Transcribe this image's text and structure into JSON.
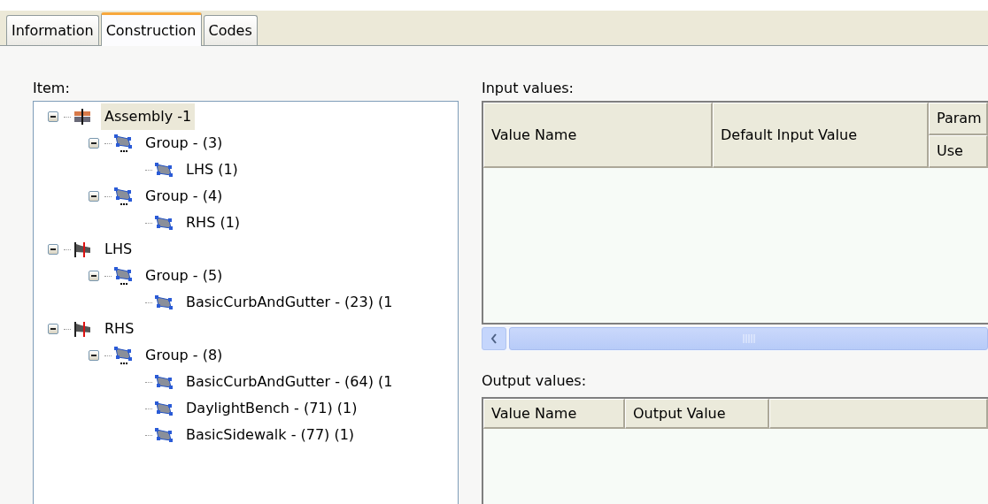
{
  "tabs": [
    {
      "label": "Information",
      "selected": false
    },
    {
      "label": "Construction",
      "selected": true
    },
    {
      "label": "Codes",
      "selected": false
    }
  ],
  "item_tree": {
    "label": "Item:",
    "nodes": [
      {
        "label": "Assembly -1",
        "kind": "assembly",
        "selected": true,
        "expanded": true,
        "children": [
          {
            "label": "Group - (3)",
            "kind": "group",
            "selected": false,
            "expanded": true,
            "children": [
              {
                "label": "LHS (1)",
                "kind": "subassembly",
                "selected": false
              }
            ]
          },
          {
            "label": "Group - (4)",
            "kind": "group",
            "selected": false,
            "expanded": true,
            "children": [
              {
                "label": "RHS (1)",
                "kind": "subassembly",
                "selected": false
              }
            ]
          }
        ]
      },
      {
        "label": "LHS",
        "kind": "baseline",
        "selected": false,
        "expanded": true,
        "children": [
          {
            "label": "Group - (5)",
            "kind": "group",
            "selected": false,
            "expanded": true,
            "children": [
              {
                "label": "BasicCurbAndGutter - (23) (1",
                "kind": "subassembly",
                "selected": false
              }
            ]
          }
        ]
      },
      {
        "label": "RHS",
        "kind": "baseline",
        "selected": false,
        "expanded": true,
        "children": [
          {
            "label": "Group - (8)",
            "kind": "group",
            "selected": false,
            "expanded": true,
            "children": [
              {
                "label": "BasicCurbAndGutter - (64) (1",
                "kind": "subassembly",
                "selected": false
              },
              {
                "label": "DaylightBench - (71) (1)",
                "kind": "subassembly",
                "selected": false
              },
              {
                "label": "BasicSidewalk - (77) (1)",
                "kind": "subassembly",
                "selected": false
              }
            ]
          }
        ]
      }
    ]
  },
  "input_values": {
    "label": "Input values:",
    "columns": [
      "Value Name",
      "Default Input Value"
    ],
    "column_group": "Param",
    "column_sub": "Use"
  },
  "output_values": {
    "label": "Output values:",
    "columns": [
      "Value Name",
      "Output Value"
    ]
  }
}
